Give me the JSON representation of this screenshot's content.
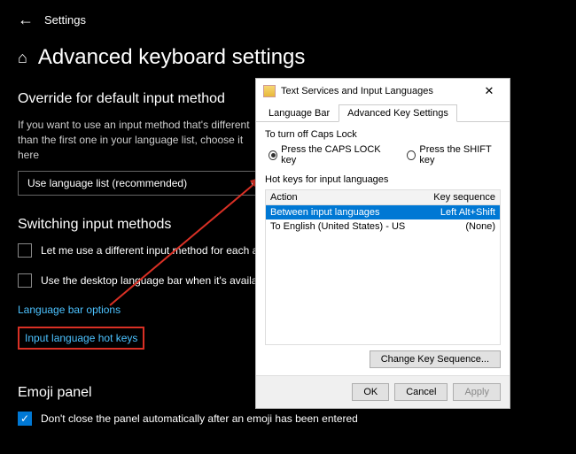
{
  "header": {
    "back": "←",
    "settings": "Settings"
  },
  "title": {
    "home_icon": "⌂",
    "text": "Advanced keyboard settings"
  },
  "override": {
    "heading": "Override for default input method",
    "desc": "If you want to use an input method that's different than the first one in your language list, choose it here",
    "dropdown": "Use language list (recommended)"
  },
  "switching": {
    "heading": "Switching input methods",
    "cb1": "Let me use a different input method for each app window",
    "cb2": "Use the desktop language bar when it's available",
    "link1": "Language bar options",
    "link2": "Input language hot keys"
  },
  "emoji": {
    "heading": "Emoji panel",
    "cb1": "Don't close the panel automatically after an emoji has been entered"
  },
  "dialog": {
    "title": "Text Services and Input Languages",
    "tabs": {
      "t1": "Language Bar",
      "t2": "Advanced Key Settings"
    },
    "capslock": {
      "label": "To turn off Caps Lock",
      "r1": "Press the CAPS LOCK key",
      "r2": "Press the SHIFT key"
    },
    "hotkeys": {
      "label": "Hot keys for input languages",
      "col_action": "Action",
      "col_key": "Key sequence",
      "rows": [
        {
          "action": "Between input languages",
          "key": "Left Alt+Shift"
        },
        {
          "action": "To English (United States) - US",
          "key": "(None)"
        }
      ],
      "change": "Change Key Sequence..."
    },
    "buttons": {
      "ok": "OK",
      "cancel": "Cancel",
      "apply": "Apply"
    }
  }
}
